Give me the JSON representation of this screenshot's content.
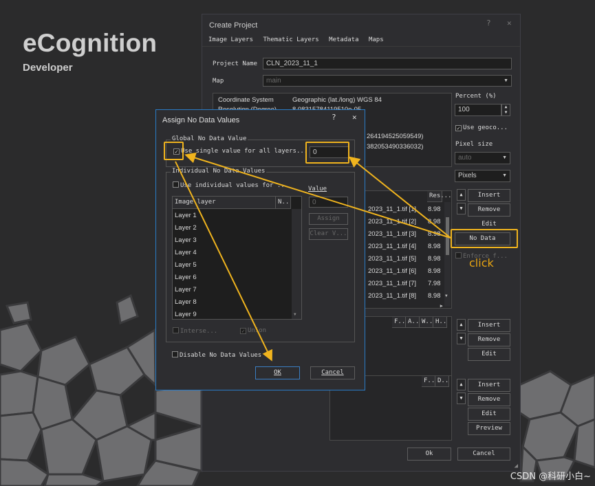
{
  "brand": {
    "title": "eCognition",
    "subtitle": "Developer"
  },
  "watermark": "CSDN @科研小白~",
  "colors": {
    "highlight": "#f0b41e",
    "dialog_border": "#2a7cc7"
  },
  "create_project": {
    "title": "Create Project",
    "help_icon": "?",
    "close_icon": "✕",
    "menu": [
      "Image Layers",
      "Thematic Layers",
      "Metadata",
      "Maps"
    ],
    "project_name_label": "Project Name",
    "project_name_value": "CLN_2023_11_1",
    "map_label": "Map",
    "map_value": "main",
    "info": {
      "coord_label": "Coordinate System",
      "coord_value": "Geographic (lat./long)  WGS 84",
      "res_label": "Resolution (Degree)",
      "res_value": "8.08315784119510e-05",
      "line3": "264194525059549)",
      "line4": "382053490336032)"
    },
    "percent_label": "Percent (%)",
    "percent_value": "100",
    "use_geocoding_label": "Use geoco...",
    "pixel_size_label": "Pixel size",
    "pixel_size_value": "auto",
    "unit_value": "Pixels",
    "layers_header_res": "Res...",
    "layers": [
      {
        "file": "2023_11_1.tif [1]",
        "res": "8.98"
      },
      {
        "file": "2023_11_1.tif [2]",
        "res": "8.98"
      },
      {
        "file": "2023_11_1.tif [3]",
        "res": "8.98"
      },
      {
        "file": "2023_11_1.tif [4]",
        "res": "8.98"
      },
      {
        "file": "2023_11_1.tif [5]",
        "res": "8.98"
      },
      {
        "file": "2023_11_1.tif [6]",
        "res": "8.98"
      },
      {
        "file": "2023_11_1.tif [7]",
        "res": "7.98"
      },
      {
        "file": "2023_11_1.tif [8]",
        "res": "8.98"
      }
    ],
    "image_buttons": {
      "insert": "Insert",
      "remove": "Remove",
      "edit": "Edit",
      "no_data": "No Data",
      "enforce": "Enforce f..."
    },
    "thematic_headers": [
      "F..",
      "A..",
      "W..",
      "H.."
    ],
    "thematic_buttons": {
      "insert": "Insert",
      "remove": "Remove",
      "edit": "Edit"
    },
    "metadata_headers": [
      "F..",
      "D.."
    ],
    "metadata_buttons": {
      "insert": "Insert",
      "remove": "Remove",
      "edit": "Edit",
      "preview": "Preview"
    },
    "ok": "Ok",
    "cancel": "Cancel"
  },
  "assign_dialog": {
    "title": "Assign No Data Values",
    "help_icon": "?",
    "close_icon": "✕",
    "global_group": "Global No Data Value",
    "use_single_label": "Use single value for all layers...",
    "use_single_checked": "✓",
    "global_value": "0",
    "individual_group": "Individual No Data Values",
    "use_individual_label": "Use individual values for ...",
    "value_label": "Value",
    "value_field": "0",
    "assign_btn": "Assign",
    "clear_btn": "Clear V...",
    "list_headers": [
      "Image layer",
      "N.."
    ],
    "layers": [
      "Layer 1",
      "Layer 2",
      "Layer 3",
      "Layer 4",
      "Layer 5",
      "Layer 6",
      "Layer 7",
      "Layer 8",
      "Layer 9"
    ],
    "intersect_label": "Interse...",
    "union_label": "Union",
    "disable_label": "Disable No Data Values",
    "ok": "OK",
    "cancel": "Cancel"
  },
  "annotation": {
    "click_label": "click"
  }
}
